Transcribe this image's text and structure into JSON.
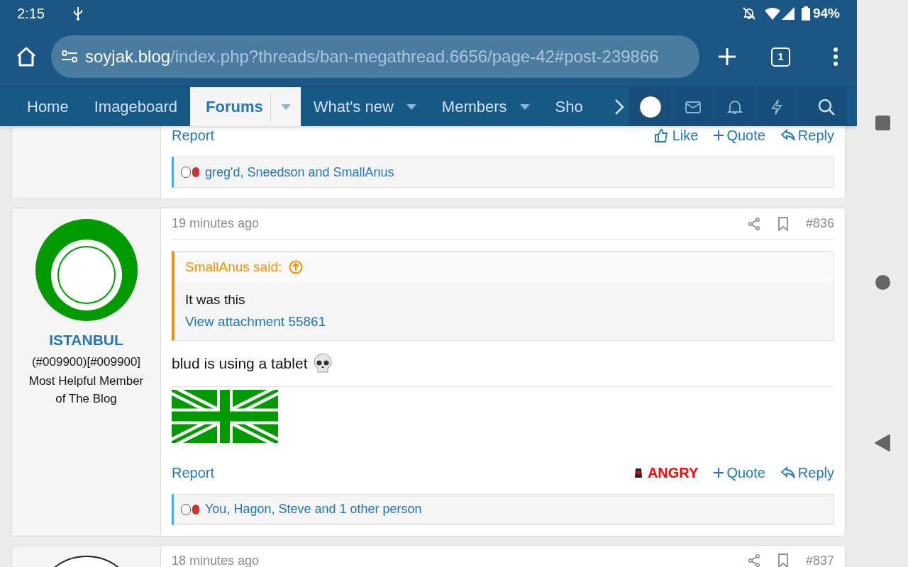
{
  "status_bar": {
    "time": "2:15",
    "battery": "94%"
  },
  "browser": {
    "url_host": "soyjak.blog",
    "url_path": "/index.php?threads/ban-megathread.6656/page-42#post-239866",
    "tab_count": "1"
  },
  "nav": {
    "items": [
      {
        "label": "Home",
        "selected": false,
        "dropdown": false
      },
      {
        "label": "Imageboard",
        "selected": false,
        "dropdown": false
      },
      {
        "label": "Forums",
        "selected": true,
        "dropdown": true
      },
      {
        "label": "What's new",
        "selected": false,
        "dropdown": true
      },
      {
        "label": "Members",
        "selected": false,
        "dropdown": true
      },
      {
        "label": "Sho",
        "selected": false,
        "dropdown": false
      }
    ]
  },
  "posts": [
    {
      "kind": "partial_top",
      "actions": {
        "report": "Report",
        "reaction": {
          "kind": "like",
          "label": "Like"
        },
        "quote": "Quote",
        "reply": "Reply"
      },
      "reactions_summary": "greg'd, Sneedson and SmallAnus"
    },
    {
      "kind": "full",
      "time": "19 minutes ago",
      "number": "#836",
      "user": {
        "name": "ISTANBUL",
        "title": "(#009900)[#009900]",
        "banner": "Most Helpful Member of The Blog"
      },
      "quote": {
        "author": "SmallAnus said:",
        "text": "It was this",
        "link": "View attachment 55861"
      },
      "body": "blud is using a tablet",
      "actions": {
        "report": "Report",
        "reaction": {
          "kind": "angry",
          "label": "ANGRY"
        },
        "quote": "Quote",
        "reply": "Reply"
      },
      "reactions_summary": "You, Hagon, Steve and 1 other person"
    },
    {
      "kind": "partial_bottom",
      "time": "18 minutes ago",
      "number": "#837"
    }
  ]
}
